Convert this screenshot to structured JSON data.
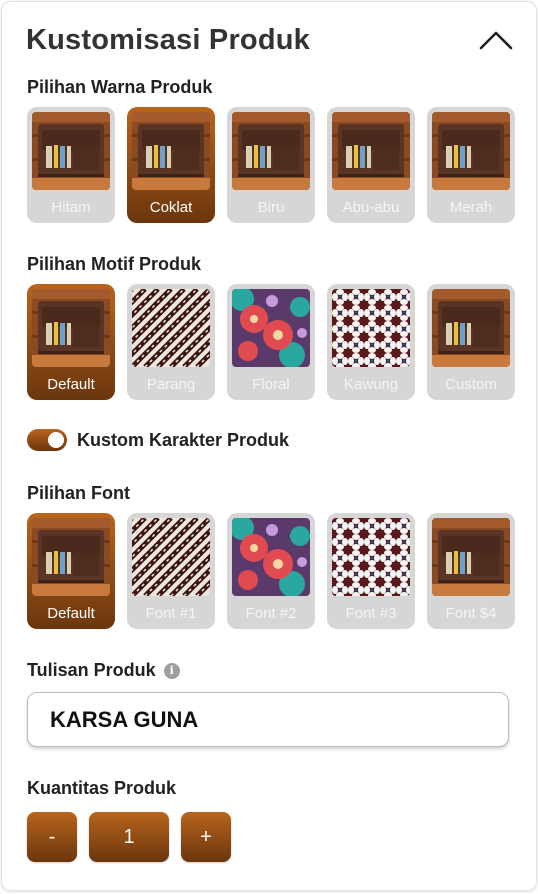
{
  "header": {
    "title": "Kustomisasi Produk",
    "collapse_icon": "chevron-up-icon"
  },
  "colors": {
    "accent": "#b8651c",
    "accent_dark": "#6b360e",
    "unselected": "#d6d6d6"
  },
  "warna": {
    "label": "Pilihan Warna Produk",
    "selected": "Coklat",
    "options": [
      {
        "label": "Hitam",
        "image": "wallet"
      },
      {
        "label": "Coklat",
        "image": "wallet"
      },
      {
        "label": "Biru",
        "image": "wallet"
      },
      {
        "label": "Abu-abu",
        "image": "wallet"
      },
      {
        "label": "Merah",
        "image": "wallet"
      }
    ]
  },
  "motif": {
    "label": "Pilihan Motif Produk",
    "selected": "Default",
    "options": [
      {
        "label": "Default",
        "image": "wallet"
      },
      {
        "label": "Parang",
        "image": "parang"
      },
      {
        "label": "Floral",
        "image": "floral"
      },
      {
        "label": "Kawung",
        "image": "kawung"
      },
      {
        "label": "Custom",
        "image": "wallet"
      }
    ]
  },
  "kustom": {
    "label": "Kustom Karakter Produk",
    "enabled": true
  },
  "font": {
    "label": "Pilihan Font",
    "selected": "Default",
    "options": [
      {
        "label": "Default",
        "image": "wallet"
      },
      {
        "label": "Font #1",
        "image": "parang"
      },
      {
        "label": "Font #2",
        "image": "floral"
      },
      {
        "label": "Font #3",
        "image": "kawung"
      },
      {
        "label": "Font $4",
        "image": "wallet"
      }
    ]
  },
  "tulisan": {
    "label": "Tulisan Produk",
    "info_icon": "info-icon",
    "value": "KARSA GUNA"
  },
  "kuantitas": {
    "label": "Kuantitas Produk",
    "minus_label": "-",
    "value": "1",
    "plus_label": "+"
  }
}
